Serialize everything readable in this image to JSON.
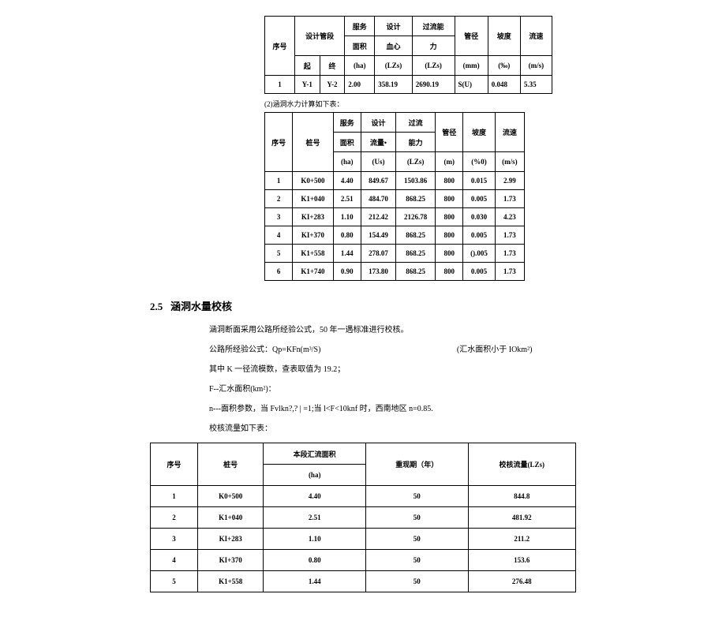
{
  "table1": {
    "headers": {
      "seq": "序号",
      "segment": "设计管段",
      "qi": "起",
      "zhong": "终",
      "service_area": "服务",
      "service_area2": "面积",
      "service_unit": "(ha)",
      "design": "设计",
      "design2": "血心",
      "design_unit": "(LZs)",
      "overflow": "过流能",
      "overflow2": "力",
      "overflow_unit": "(LZs)",
      "diameter": "管径",
      "diameter_unit": "(mm)",
      "slope": "坡度",
      "slope_unit": "(‰)",
      "velocity": "流速",
      "velocity_unit": "(m/s)"
    },
    "rows": [
      {
        "seq": "1",
        "qi": "Y-1",
        "zhong": "Y-2",
        "area": "2.00",
        "design": "358.19",
        "overflow": "2690.19",
        "diameter": "S(U)",
        "slope": "0.048",
        "velocity": "5.35"
      }
    ]
  },
  "note1": "(2)涵洞水力计算如下表：",
  "table2": {
    "headers": {
      "seq": "序号",
      "stake": "桩号",
      "service_area": "服务",
      "service_area2": "面积",
      "service_unit": "(ha)",
      "design": "设计",
      "design2": "流量•",
      "design_unit": "(Us)",
      "overflow": "过流",
      "overflow2": "能力",
      "overflow_unit": "(LZs)",
      "diameter": "管径",
      "diameter_unit": "(m)",
      "slope": "坡度",
      "slope_unit": "(%0)",
      "velocity": "流速",
      "velocity_unit": "(m/s)"
    },
    "rows": [
      {
        "seq": "1",
        "stake": "K0+500",
        "area": "4.40",
        "design": "849.67",
        "overflow": "1503.86",
        "diameter": "800",
        "slope": "0.015",
        "velocity": "2.99"
      },
      {
        "seq": "2",
        "stake": "K1+040",
        "area": "2.51",
        "design": "484.70",
        "overflow": "868.25",
        "diameter": "800",
        "slope": "0.005",
        "velocity": "1.73"
      },
      {
        "seq": "3",
        "stake": "KI+283",
        "area": "1.10",
        "design": "212.42",
        "overflow": "2126.78",
        "diameter": "800",
        "slope": "0.030",
        "velocity": "4.23"
      },
      {
        "seq": "4",
        "stake": "KI+370",
        "area": "0.80",
        "design": "154.49",
        "overflow": "868.25",
        "diameter": "800",
        "slope": "0.005",
        "velocity": "1.73"
      },
      {
        "seq": "5",
        "stake": "K1+558",
        "area": "1.44",
        "design": "278.07",
        "overflow": "868.25",
        "diameter": "800",
        "slope": "().005",
        "velocity": "1.73"
      },
      {
        "seq": "6",
        "stake": "K1+740",
        "area": "0.90",
        "design": "173.80",
        "overflow": "868.25",
        "diameter": "800",
        "slope": "0.005",
        "velocity": "1.73"
      }
    ]
  },
  "section": {
    "number": "2.5",
    "title": "涵洞水量校核"
  },
  "paragraphs": {
    "p1": "涵洞断面采用公路所经验公式，50 年一遇标准进行校核。",
    "p2a": "公路所经验公式：Qp=KFn(m³/S)",
    "p2b": "(汇水面积小于 IOkm²)",
    "p3": "其中 K 一径流模数，查表取值为 19.2；",
    "p4": "F--汇水面积(km²)：",
    "p5": "n---面积参数，当 Fvlkn?,? | =1;当 l<F<10knf 时，西南地区 n=0.85.",
    "p6": "校核流量如下表："
  },
  "table3": {
    "headers": {
      "seq": "序号",
      "stake": "桩号",
      "catchment": "本段汇流面积",
      "catchment_unit": "(ha)",
      "return_period": "重现期（年）",
      "check_flow": "校核流量(LZs)"
    },
    "rows": [
      {
        "seq": "1",
        "stake": "K0+500",
        "area": "4.40",
        "period": "50",
        "flow": "844.8"
      },
      {
        "seq": "2",
        "stake": "K1+040",
        "area": "2.51",
        "period": "50",
        "flow": "481.92"
      },
      {
        "seq": "3",
        "stake": "KI+283",
        "area": "1.10",
        "period": "50",
        "flow": "211.2"
      },
      {
        "seq": "4",
        "stake": "KI+370",
        "area": "0.80",
        "period": "50",
        "flow": "153.6"
      },
      {
        "seq": "5",
        "stake": "K1+558",
        "area": "1.44",
        "period": "50",
        "flow": "276.48"
      }
    ]
  }
}
